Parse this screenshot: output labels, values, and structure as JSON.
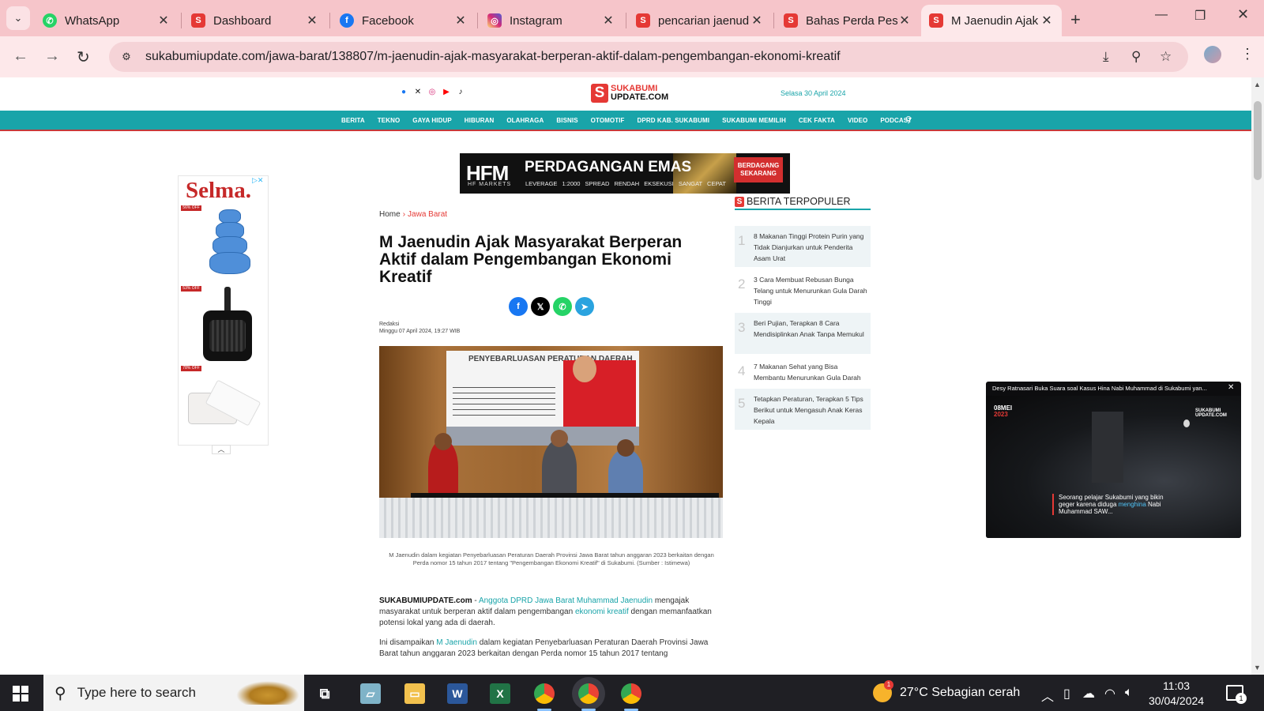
{
  "browser": {
    "tabs": [
      {
        "title": "WhatsApp",
        "icon": "whatsapp-icon",
        "color": "#25d366"
      },
      {
        "title": "Dashboard",
        "icon": "sukabumi-icon",
        "color": "#e53935"
      },
      {
        "title": "Facebook",
        "icon": "facebook-icon",
        "color": "#1877f2"
      },
      {
        "title": "Instagram",
        "icon": "instagram-icon",
        "color": "#d6249f"
      },
      {
        "title": "pencarian jaenudin",
        "icon": "sukabumi-icon",
        "color": "#e53935"
      },
      {
        "title": "Bahas Perda Pesantren",
        "icon": "sukabumi-icon",
        "color": "#e53935"
      },
      {
        "title": "M Jaenudin Ajak",
        "icon": "sukabumi-icon",
        "color": "#e53935",
        "active": true
      }
    ],
    "url": "sukabumiupdate.com/jawa-barat/138807/m-jaenudin-ajak-masyarakat-berperan-aktif-dalam-pengembangan-ekonomi-kreatif"
  },
  "site": {
    "logo_top": "SUKABUMI",
    "logo_bottom": "UPDATE.COM",
    "date": "Selasa 30 April 2024",
    "nav": [
      "BERITA",
      "TEKNO",
      "GAYA HIDUP",
      "HIBURAN",
      "OLAHRAGA",
      "BISNIS",
      "OTOMOTIF",
      "DPRD KAB. SUKABUMI",
      "SUKABUMI MEMILIH",
      "CEK FAKTA",
      "VIDEO",
      "PODCAST"
    ]
  },
  "banner": {
    "brand": "HFM",
    "brand_sub": "HF MARKETS",
    "headline": "PERDAGANGAN EMAS",
    "features": "LEVERAGE 1:2000   SPREAD RENDAH   EKSEKUSI SANGAT CEPAT",
    "cta": "BERDAGANG SEKARANG"
  },
  "left_ad": {
    "brand": "Selma.",
    "badges": [
      "56% OFF",
      "53% OFF",
      "78% OFF"
    ]
  },
  "article": {
    "breadcrumb_home": "Home",
    "breadcrumb_section": "Jawa Barat",
    "title": "M Jaenudin Ajak Masyarakat Berperan Aktif dalam Pengembangan Ekonomi Kreatif",
    "author": "Redaksi",
    "datetime": "Minggu 07 April 2024, 19:27 WIB",
    "photo_banner_heading": "PENYEBARLUASAN PERATURAN DAERAH",
    "caption": "M Jaenudin dalam kegiatan Penyebarluasan Peraturan Daerah Provinsi Jawa Barat tahun anggaran 2023 berkaitan dengan Perda nomor 15 tahun 2017 tentang \"Pengembangan Ekonomi Kreatif\" di Sukabumi. (Sumber : Istimewa)",
    "p1_source": "SUKABUMIUPDATE.com",
    "p1_dash": " - ",
    "p1_link1": "Anggota DPRD Jawa Barat Muhammad Jaenudin",
    "p1_text1": " mengajak masyarakat untuk berperan aktif dalam pengembangan ",
    "p1_link2": "ekonomi kreatif",
    "p1_text2": " dengan memanfaatkan potensi lokal yang ada di daerah.",
    "p2_text1": "Ini disampaikan ",
    "p2_link": "M Jaenudin",
    "p2_text2": " dalam kegiatan Penyebarluasan Peraturan Daerah Provinsi Jawa Barat tahun anggaran 2023 berkaitan dengan Perda nomor 15 tahun 2017 tentang"
  },
  "popular": {
    "heading": "BERITA TERPOPULER",
    "items": [
      {
        "num": "1",
        "text": "8 Makanan Tinggi Protein Purin yang Tidak Dianjurkan untuk Penderita Asam Urat"
      },
      {
        "num": "2",
        "text": "3 Cara Membuat Rebusan Bunga Telang untuk Menurunkan Gula Darah Tinggi"
      },
      {
        "num": "3",
        "text": "Beri Pujian, Terapkan 8 Cara Mendisiplinkan Anak Tanpa Memukul"
      },
      {
        "num": "4",
        "text": "7 Makanan Sehat yang Bisa Membantu Menurunkan Gula Darah"
      },
      {
        "num": "5",
        "text": "Tetapkan Peraturan, Terapkan 5 Tips Berikut untuk Mengasuh Anak Keras Kepala"
      }
    ]
  },
  "video": {
    "title": "Desy Ratnasari Buka Suara soal Kasus Hina Nabi Muhammad di Sukabumi yan...",
    "tag_date": "08MEI",
    "tag_year": "2023",
    "watermark": "SUKABUMI UPDATE.COM",
    "caption_a": "Seorang pelajar Sukabumi yang bikin geger karena diduga ",
    "caption_b": "menghina",
    "caption_c": " Nabi Muhammad SAW..."
  },
  "taskbar": {
    "search_placeholder": "Type here to search",
    "weather": "27°C  Sebagian cerah",
    "time": "11:03",
    "date": "30/04/2024",
    "notifications": "1"
  }
}
